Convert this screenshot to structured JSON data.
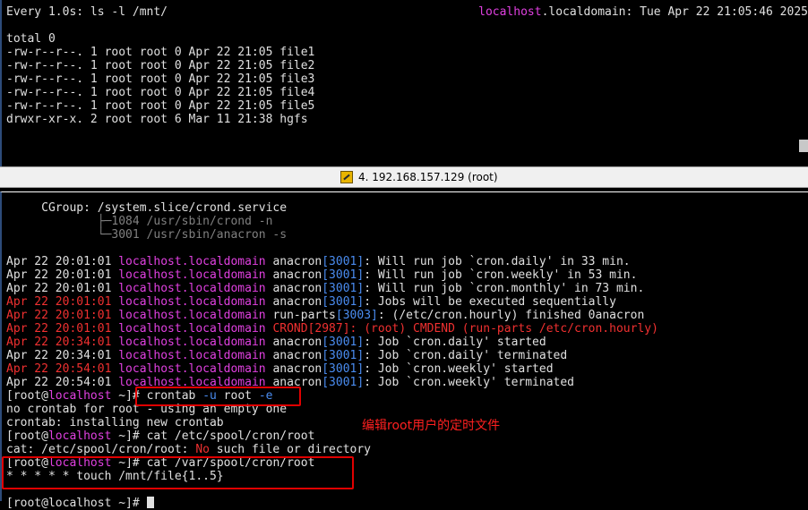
{
  "top_pane": {
    "header_left": "Every 1.0s: ls -l /mnt/",
    "header_host": "localhost",
    "header_rest": ".localdomain: Tue Apr 22 21:05:46 2025",
    "lines": [
      "",
      "total 0",
      "-rw-r--r--. 1 root root 0 Apr 22 21:05 file1",
      "-rw-r--r--. 1 root root 0 Apr 22 21:05 file2",
      "-rw-r--r--. 1 root root 0 Apr 22 21:05 file3",
      "-rw-r--r--. 1 root root 0 Apr 22 21:05 file4",
      "-rw-r--r--. 1 root root 0 Apr 22 21:05 file5",
      "drwxr-xr-x. 2 root root 6 Mar 11 21:38 hgfs"
    ]
  },
  "tab": {
    "icon": "terminal-tab-icon",
    "label": "4. 192.168.157.129 (root)"
  },
  "bottom_pane": {
    "cgroup": "     CGroup: /system.slice/crond.service",
    "tree1": "             ├─1084 /usr/sbin/crond -n",
    "tree2": "             └─3001 /usr/sbin/anacron -s",
    "logs": [
      {
        "date": "Apr 22 20:01:01",
        "host": "localhost",
        "domain": ".localdomain",
        "proc": "anacron",
        "pid": "[3001]",
        "msg": ": Will run job `cron.daily' in 33 min.",
        "red": false
      },
      {
        "date": "Apr 22 20:01:01",
        "host": "localhost",
        "domain": ".localdomain",
        "proc": "anacron",
        "pid": "[3001]",
        "msg": ": Will run job `cron.weekly' in 53 min.",
        "red": false
      },
      {
        "date": "Apr 22 20:01:01",
        "host": "localhost",
        "domain": ".localdomain",
        "proc": "anacron",
        "pid": "[3001]",
        "msg": ": Will run job `cron.monthly' in 73 min.",
        "red": false
      },
      {
        "date": "Apr 22 20:01:01",
        "host": "localhost",
        "domain": ".localdomain",
        "proc": "anacron",
        "pid": "[3001]",
        "msg": ": Jobs will be executed sequentially",
        "red": true
      },
      {
        "date": "Apr 22 20:01:01",
        "host": "localhost",
        "domain": ".localdomain",
        "proc": "run-parts",
        "pid": "[3003]",
        "msg": ": (/etc/cron.hourly) finished 0anacron",
        "red": true
      },
      {
        "date": "Apr 22 20:01:01",
        "host": "localhost",
        "domain": ".localdomain",
        "proc": "CROND",
        "pid": "[2987]",
        "msg": ": (root) CMDEND (run-parts /etc/cron.hourly)",
        "red": true,
        "allred": true
      },
      {
        "date": "Apr 22 20:34:01",
        "host": "localhost",
        "domain": ".localdomain",
        "proc": "anacron",
        "pid": "[3001]",
        "msg": ": Job `cron.daily' started",
        "red": true
      },
      {
        "date": "Apr 22 20:34:01",
        "host": "localhost",
        "domain": ".localdomain",
        "proc": "anacron",
        "pid": "[3001]",
        "msg": ": Job `cron.daily' terminated",
        "red": false
      },
      {
        "date": "Apr 22 20:54:01",
        "host": "localhost",
        "domain": ".localdomain",
        "proc": "anacron",
        "pid": "[3001]",
        "msg": ": Job `cron.weekly' started",
        "red": true
      },
      {
        "date": "Apr 22 20:54:01",
        "host": "localhost",
        "domain": ".localdomain",
        "proc": "anacron",
        "pid": "[3001]",
        "msg": ": Job `cron.weekly' terminated",
        "red": false
      }
    ],
    "prompt_open": "[root@",
    "prompt_host": "localhost",
    "prompt_close": " ~]# ",
    "cmd1_name": "crontab",
    "cmd1_flag_u": "-u",
    "cmd1_user": "root",
    "cmd1_flag_e": "-e",
    "out1a": "no crontab for root - using an empty one",
    "out1b": "crontab: installing new crontab",
    "cmd2": "cat /etc/spool/cron/root",
    "out2_prefix": "cat: /etc/spool/cron/root: ",
    "out2_no": "No",
    "out2_rest": " such file or directory",
    "cmd3": "cat /var/spool/cron/root",
    "out3": "* * * * * touch /mnt/file{1..5}",
    "last_prompt_partial": "[root@localhost ~]# "
  },
  "annotation": "编辑root用户的定时文件",
  "colors": {
    "magenta": "#e040e0",
    "blue": "#4a8cf0",
    "red": "#f03030",
    "box": "#e00000"
  }
}
